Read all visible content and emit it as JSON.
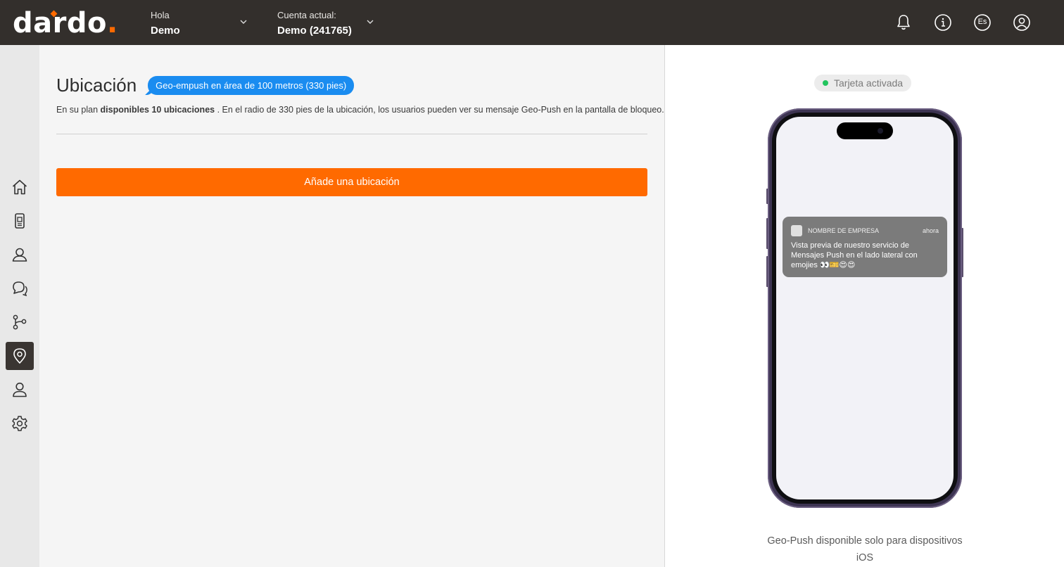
{
  "brand": {
    "logo_text": "dardo",
    "logo_dot": ".",
    "accent": "#ff6a00"
  },
  "header": {
    "greeting_label": "Hola",
    "user_name": "Demo",
    "account_label": "Cuenta actual:",
    "account_value": "Demo (241765)",
    "icons": [
      "bell-icon",
      "info-icon",
      "language-icon",
      "user-circle-icon"
    ],
    "language_code": "Es"
  },
  "sidebar": {
    "items": [
      {
        "name": "home",
        "icon": "home-icon",
        "active": false
      },
      {
        "name": "cards",
        "icon": "phone-card-icon",
        "active": false
      },
      {
        "name": "customers",
        "icon": "users-icon",
        "active": false
      },
      {
        "name": "messages",
        "icon": "chat-icon",
        "active": false
      },
      {
        "name": "automations",
        "icon": "flow-icon",
        "active": false
      },
      {
        "name": "locations",
        "icon": "location-pin-icon",
        "active": true
      },
      {
        "name": "profile",
        "icon": "person-icon",
        "active": false
      },
      {
        "name": "settings",
        "icon": "gear-icon",
        "active": false
      }
    ]
  },
  "main": {
    "title": "Ubicación",
    "badge": "Geo-empush en área de 100 metros (330 pies)",
    "desc_prefix": "En su plan ",
    "desc_bold": "disponibles 10 ubicaciones",
    "desc_suffix": " . En el radio de 330 pies de la ubicación, los usuarios pueden ver su mensaje Geo-Push en la pantalla de bloqueo.",
    "add_button": "Añade una ubicación"
  },
  "preview": {
    "status": "Tarjeta activada",
    "status_color": "#22c55e",
    "notification": {
      "app_name": "NOMBRE DE EMPRESA",
      "time": "ahora",
      "body": "Vista previa de nuestro servicio de Mensajes Push en el lado lateral con emojies 👀🎫😍😍"
    },
    "note": "Geo-Push disponible solo para dispositivos iOS"
  }
}
